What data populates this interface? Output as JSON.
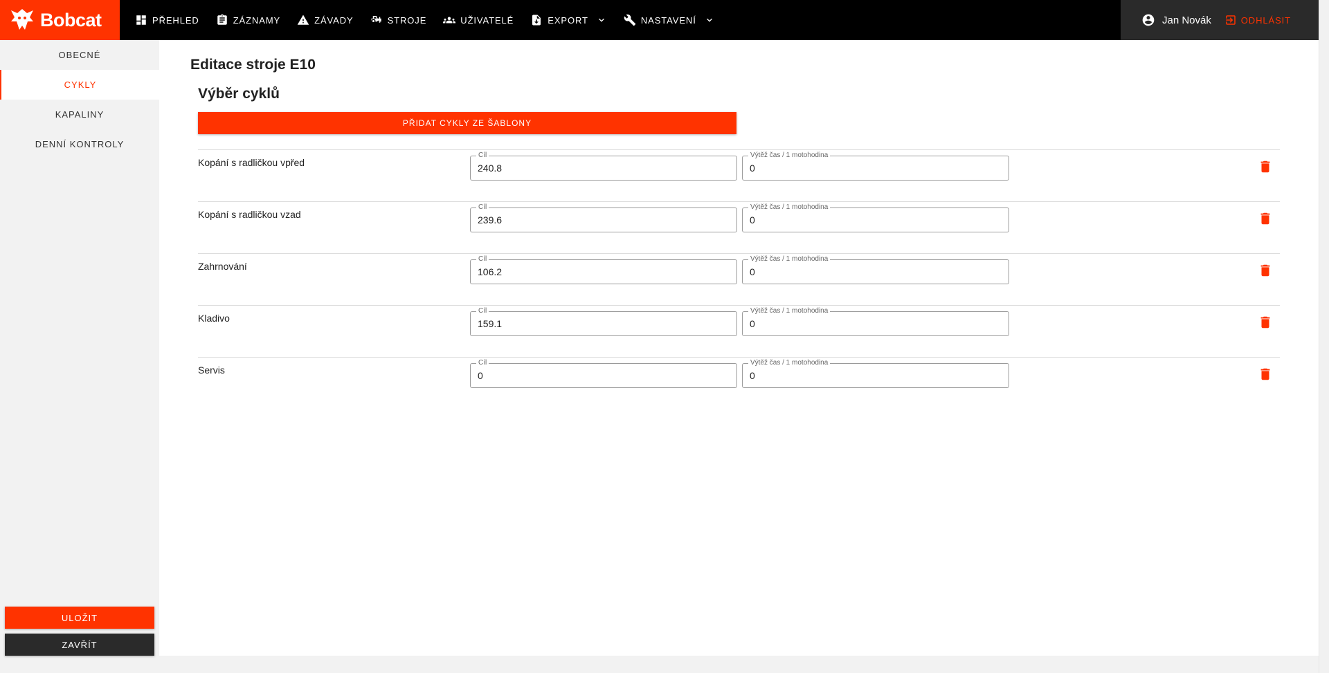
{
  "brand": {
    "name": "Bobcat",
    "color": "#ff3300"
  },
  "nav": [
    {
      "label": "Přehled",
      "icon": "dashboard-icon"
    },
    {
      "label": "Záznamy",
      "icon": "clipboard-icon"
    },
    {
      "label": "Závady",
      "icon": "warning-icon"
    },
    {
      "label": "Stroje",
      "icon": "tractor-icon"
    },
    {
      "label": "Uživatelé",
      "icon": "users-icon"
    },
    {
      "label": "Export",
      "icon": "file-export-icon",
      "dropdown": true
    },
    {
      "label": "Nastavení",
      "icon": "wrench-icon",
      "dropdown": true
    }
  ],
  "user": {
    "name": "Jan Novák",
    "logout_label": "Odhlásit"
  },
  "sidebar": {
    "items": [
      {
        "label": "Obecné",
        "active": false
      },
      {
        "label": "Cykly",
        "active": true
      },
      {
        "label": "Kapaliny",
        "active": false
      },
      {
        "label": "Denní kontroly",
        "active": false
      }
    ],
    "save_label": "Uložit",
    "close_label": "Zavřít"
  },
  "main": {
    "page_title": "Editace stroje E10",
    "section_title": "Výběr cyklů",
    "add_button_label": "Přidat cykly ze šablony",
    "target_label": "Cíl",
    "yield_label": "Výtěž čas / 1 motohodina",
    "cycles": [
      {
        "name": "Kopání s radličkou vpřed",
        "target": "240.8",
        "yield": "0"
      },
      {
        "name": "Kopání s radličkou vzad",
        "target": "239.6",
        "yield": "0"
      },
      {
        "name": "Zahrnování",
        "target": "106.2",
        "yield": "0"
      },
      {
        "name": "Kladivo",
        "target": "159.1",
        "yield": "0"
      },
      {
        "name": "Servis",
        "target": "0",
        "yield": "0"
      }
    ]
  }
}
